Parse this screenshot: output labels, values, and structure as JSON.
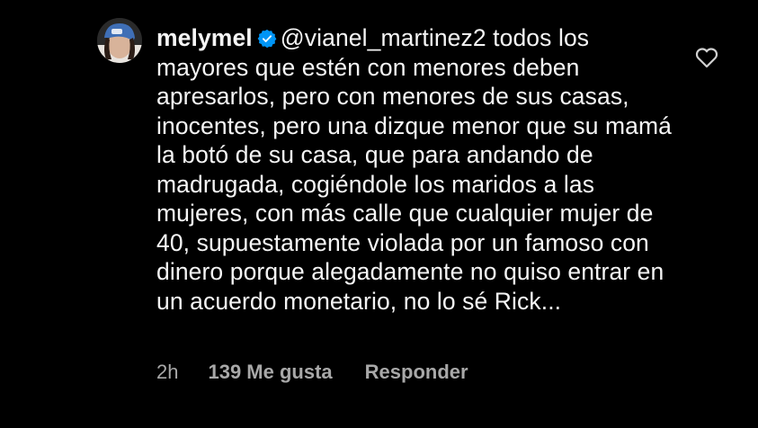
{
  "comment": {
    "username": "melymel",
    "verified": true,
    "mention": "@vianel_martinez2",
    "text": " todos los mayores que estén con menores deben apresarlos, pero con menores de sus casas, inocentes, pero una dizque menor que su mamá la botó de su casa, que para andando de madrugada, cogiéndole los maridos a las mujeres, con más calle que cualquier mujer de 40, supuestamente violada por un famoso con dinero porque alegadamente no quiso entrar en un acuerdo monetario, no lo sé Rick...",
    "time": "2h",
    "likes": "139 Me gusta",
    "reply_label": "Responder"
  },
  "icons": {
    "verified": "verified-badge-icon",
    "like": "heart-outline-icon",
    "avatar": "profile-avatar"
  },
  "colors": {
    "background": "#000000",
    "text": "#f5f5f5",
    "meta": "#a8a8a8",
    "verified_badge": "#0095f6"
  }
}
